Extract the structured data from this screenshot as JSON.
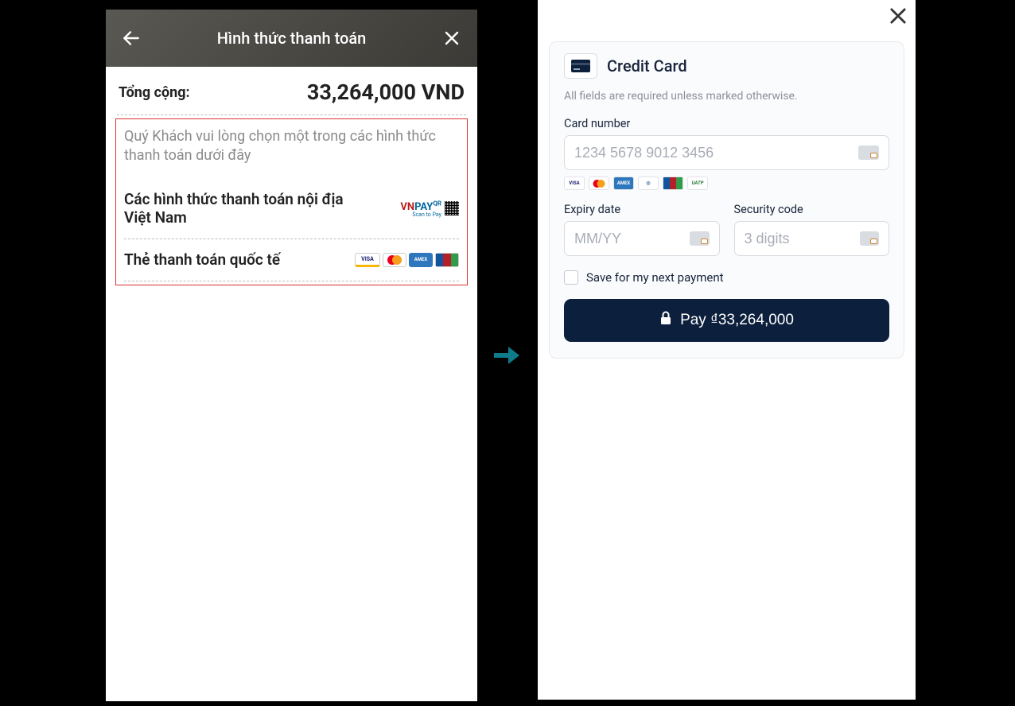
{
  "left": {
    "header_title": "Hình thức thanh toán",
    "total_label": "Tổng cộng:",
    "total_value": "33,264,000 VND",
    "instruction": "Quý Khách vui lòng chọn một trong các hình thức thanh toán dưới đây",
    "methods": [
      {
        "name": "Các hình thức thanh toán nội địa Việt Nam",
        "logos": [
          "VNPAY-QR"
        ]
      },
      {
        "name": "Thẻ thanh toán quốc tế",
        "logos": [
          "VISA",
          "MC",
          "AMEX",
          "JCB"
        ]
      }
    ]
  },
  "right": {
    "title": "Credit Card",
    "required_note": "All fields are required unless marked otherwise.",
    "card_number_label": "Card number",
    "card_number_placeholder": "1234 5678 9012 3456",
    "brands": [
      "VISA",
      "MC",
      "AMEX",
      "DINERS",
      "JCB",
      "UATP"
    ],
    "expiry_label": "Expiry date",
    "expiry_placeholder": "MM/YY",
    "cvv_label": "Security code",
    "cvv_placeholder": "3 digits",
    "save_label": "Save for my next payment",
    "pay_button": "Pay ₫33,264,000"
  }
}
